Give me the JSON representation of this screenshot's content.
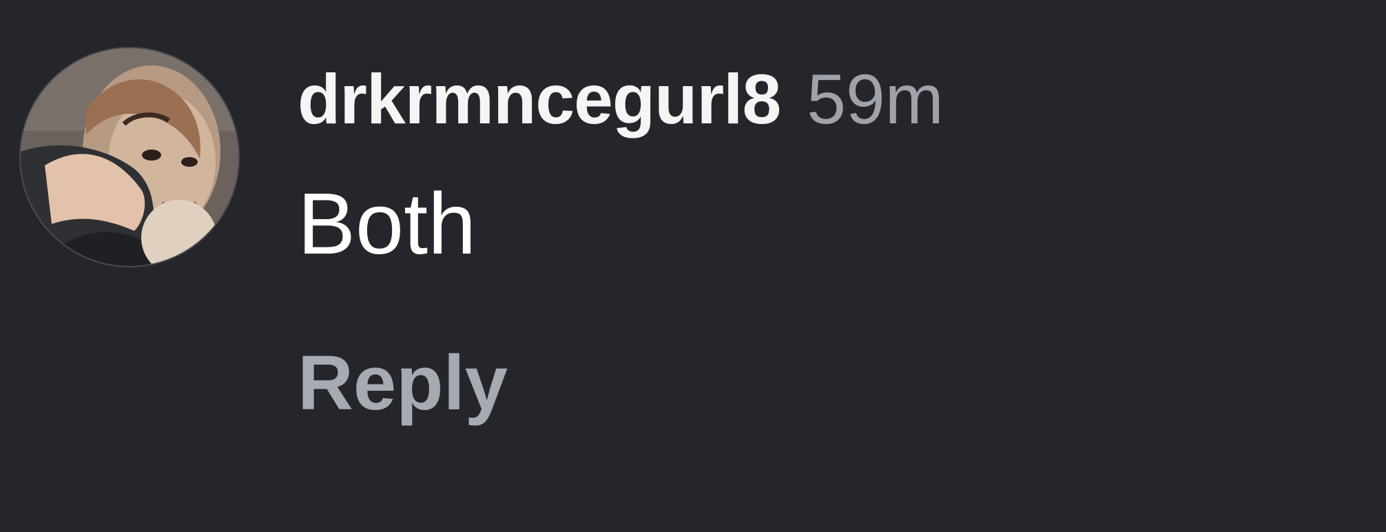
{
  "comment": {
    "username": "drkrmncegurl8",
    "timestamp": "59m",
    "text": "Both",
    "reply_label": "Reply"
  },
  "colors": {
    "background": "#25262b",
    "username": "#f5f5f5",
    "timestamp": "#9fa2a8",
    "reply": "#a6aab1"
  }
}
